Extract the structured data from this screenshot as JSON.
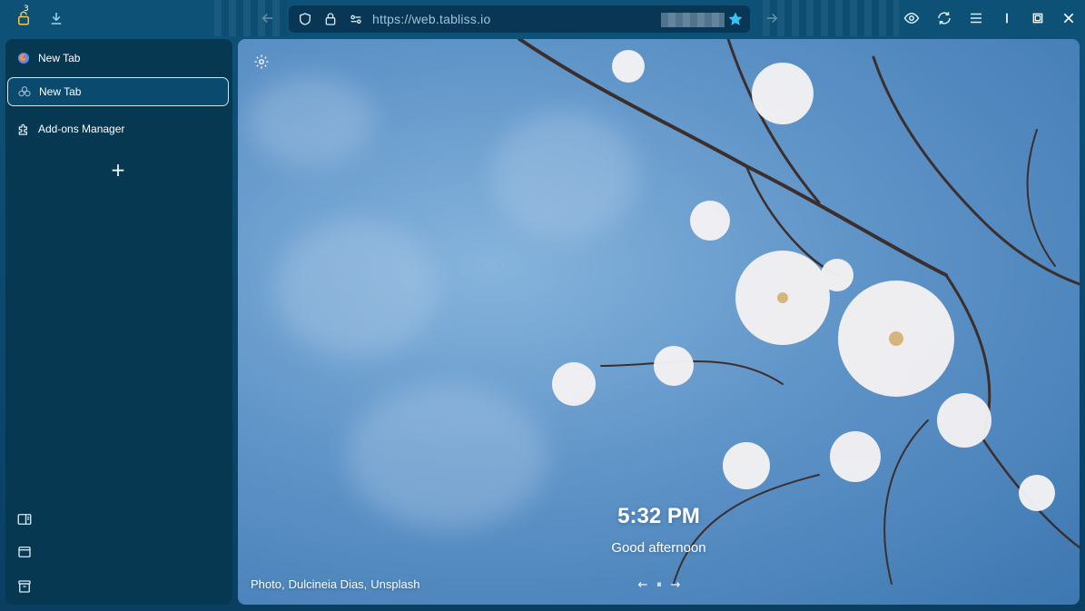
{
  "toolbar": {
    "private_badge": "3",
    "icons": [
      "private-browsing-icon",
      "download-icon",
      "back-icon",
      "forward-icon",
      "shield-icon",
      "lock-icon",
      "permissions-icon",
      "bookmark-star-icon",
      "eye-icon",
      "sync-icon",
      "menu-icon",
      "minimize-icon",
      "restore-icon",
      "close-icon"
    ]
  },
  "urlbar": {
    "url": "https://web.tabliss.io"
  },
  "sidebar": {
    "tabs": [
      {
        "label": "New Tab",
        "icon": "firefox-icon",
        "active": false
      },
      {
        "label": "New Tab",
        "icon": "tabliss-icon",
        "active": true
      },
      {
        "label": "Add-ons Manager",
        "icon": "puzzle-icon",
        "active": false
      }
    ],
    "new_tab_label": "+",
    "bottom_icons": [
      "sidebar-toggle-icon",
      "window-icon",
      "archive-icon"
    ]
  },
  "newtab": {
    "time": "5:32 PM",
    "greeting": "Good afternoon",
    "credit": {
      "prefix": "Photo,",
      "author": "Dulcineia Dias,",
      "source": "Unsplash"
    },
    "controls": {
      "prev": "←",
      "pause": "⏸",
      "next": "→"
    }
  },
  "colors": {
    "accent": "#38c4f2",
    "toolbar": "#0e5177",
    "sidebar": "#063852",
    "urlbar": "#083654"
  }
}
